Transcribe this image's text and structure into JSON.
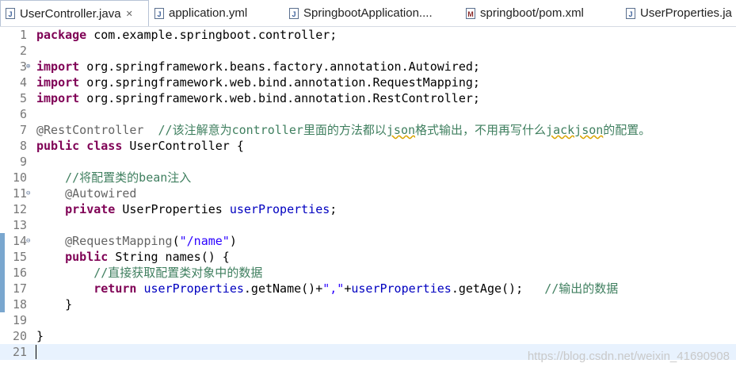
{
  "tabs": [
    {
      "label": "UserController.java",
      "icon": "java-file-icon",
      "active": true,
      "close": "✕"
    },
    {
      "label": "application.yml",
      "icon": "yml-file-icon"
    },
    {
      "label": "SpringbootApplication....",
      "icon": "java-file-icon"
    },
    {
      "label": "springboot/pom.xml",
      "icon": "maven-file-icon",
      "badge": "M"
    },
    {
      "label": "UserProperties.ja",
      "icon": "java-file-icon"
    }
  ],
  "editor": {
    "lines": [
      {
        "n": "1",
        "segs": [
          [
            "kw",
            "package"
          ],
          [
            "",
            "com.example.springboot.controller;"
          ]
        ]
      },
      {
        "n": "2",
        "segs": []
      },
      {
        "n": "3",
        "fold": "⊕",
        "segs": [
          [
            "kw",
            "import"
          ],
          [
            "",
            " org.springframework.beans.factory.annotation.Autowired;"
          ]
        ]
      },
      {
        "n": "4",
        "segs": [
          [
            "kw",
            "import"
          ],
          [
            "",
            " org.springframework.web.bind.annotation.RequestMapping;"
          ]
        ]
      },
      {
        "n": "5",
        "segs": [
          [
            "kw",
            "import"
          ],
          [
            "",
            " org.springframework.web.bind.annotation.RestController;"
          ]
        ]
      },
      {
        "n": "6",
        "segs": []
      },
      {
        "n": "7",
        "segs": [
          [
            "an",
            "@RestController  "
          ],
          [
            "cm",
            "//该注解意为controller里面的方法都以"
          ],
          [
            "cm sq",
            "json"
          ],
          [
            "cm",
            "格式输出，不用再写什么"
          ],
          [
            "cm sq",
            "jackjson"
          ],
          [
            "cm",
            "的配置。"
          ]
        ]
      },
      {
        "n": "8",
        "segs": [
          [
            "kw",
            "public"
          ],
          [
            "",
            " "
          ],
          [
            "kw",
            "class"
          ],
          [
            "",
            " UserController {"
          ]
        ]
      },
      {
        "n": "9",
        "segs": []
      },
      {
        "n": "10",
        "segs": [
          [
            "",
            "    "
          ],
          [
            "cm",
            "//将配置类的bean注入"
          ]
        ]
      },
      {
        "n": "11",
        "fold": "⊖",
        "segs": [
          [
            "",
            "    "
          ],
          [
            "an",
            "@Autowired"
          ]
        ]
      },
      {
        "n": "12",
        "segs": [
          [
            "",
            "    "
          ],
          [
            "kw",
            "private"
          ],
          [
            "",
            " UserProperties "
          ],
          [
            "fld",
            "userProperties"
          ],
          [
            "",
            ";"
          ]
        ]
      },
      {
        "n": "13",
        "segs": []
      },
      {
        "n": "14",
        "fold": "⊖",
        "segs": [
          [
            "",
            "    "
          ],
          [
            "an",
            "@RequestMapping"
          ],
          [
            "",
            "("
          ],
          [
            "str",
            "\"/name\""
          ],
          [
            "",
            ")"
          ]
        ]
      },
      {
        "n": "15",
        "segs": [
          [
            "",
            "    "
          ],
          [
            "kw",
            "public"
          ],
          [
            "",
            " String names() {"
          ]
        ]
      },
      {
        "n": "16",
        "segs": [
          [
            "",
            "        "
          ],
          [
            "cm",
            "//直接获取配置类对象中的数据"
          ]
        ]
      },
      {
        "n": "17",
        "segs": [
          [
            "",
            "        "
          ],
          [
            "kw",
            "return"
          ],
          [
            "",
            " "
          ],
          [
            "fld",
            "userProperties"
          ],
          [
            "",
            ".getName()+"
          ],
          [
            "str",
            "\",\""
          ],
          [
            "",
            "+"
          ],
          [
            "fld",
            "userProperties"
          ],
          [
            "",
            ".getAge();   "
          ],
          [
            "cm",
            "//输出的数据"
          ]
        ]
      },
      {
        "n": "18",
        "segs": [
          [
            "",
            "    }"
          ]
        ]
      },
      {
        "n": "19",
        "segs": []
      },
      {
        "n": "20",
        "segs": [
          [
            "",
            "}"
          ]
        ]
      },
      {
        "n": "21",
        "segs": [],
        "current": true
      }
    ]
  },
  "watermark": "https://blog.csdn.net/weixin_41690908",
  "colors": {
    "keyword": "#7f0055",
    "annotation": "#646464",
    "comment": "#3f7f5f",
    "field": "#0000c0",
    "string": "#2a00ff",
    "current_line": "#e8f2fe"
  }
}
